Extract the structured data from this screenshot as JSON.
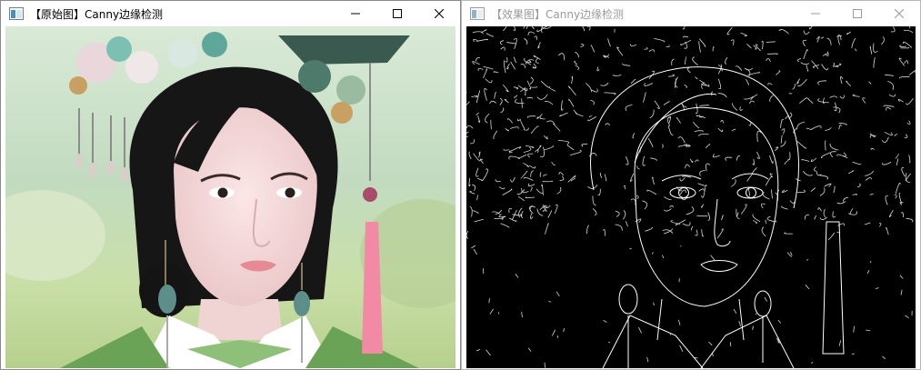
{
  "windows": {
    "original": {
      "title": "【原始图】Canny边缘检测",
      "image_icon": "image-window-icon",
      "controls": [
        "minimize-icon",
        "maximize-icon",
        "close-icon"
      ],
      "content": "photo-portrait-woman-qing-headdress"
    },
    "result": {
      "title": "【效果图】Canny边缘检测",
      "image_icon": "image-window-icon",
      "controls": [
        "minimize-icon",
        "maximize-icon",
        "close-icon"
      ],
      "content": "canny-edge-map"
    }
  },
  "colors": {
    "title_active": "#000000",
    "title_inactive": "#9a9a9a",
    "edge_background": "#000000",
    "edge_lines": "#ffffff"
  }
}
